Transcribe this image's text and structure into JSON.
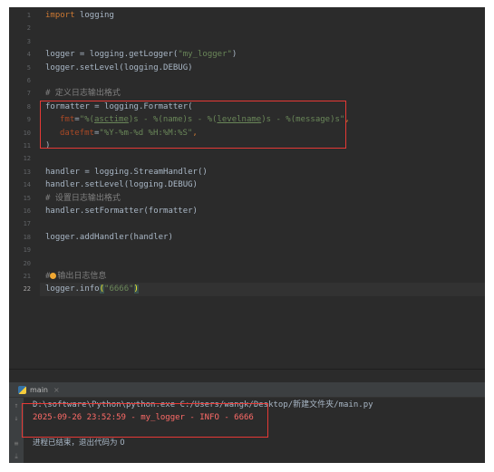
{
  "editor": {
    "line_numbers": [
      "1",
      "2",
      "3",
      "4",
      "5",
      "6",
      "7",
      "8",
      "9",
      "10",
      "11",
      "12",
      "13",
      "14",
      "15",
      "16",
      "17",
      "18",
      "19",
      "20",
      "21",
      "22"
    ],
    "current_line": "22",
    "code": {
      "l1_kw": "import",
      "l1_rest": " logging",
      "l4_a": "logger = logging.getLogger(",
      "l4_str": "\"my_logger\"",
      "l4_b": ")",
      "l5": "logger.setLevel(logging.DEBUG)",
      "l7": "# 定义日志输出格式",
      "l8": "formatter = logging.Formatter(",
      "l9_param": "fmt",
      "l9_eq": "=",
      "l9_s1": "\"%(",
      "l9_u1": "asctime",
      "l9_s2": ")s - %(name)s - %(",
      "l9_u2": "levelname",
      "l9_s3": ")s - %(message)s\"",
      "l9_end": ",",
      "l10_param": "datefmt",
      "l10_eq": "=",
      "l10_str": "\"%Y-%m-%d %H:%M:%S\"",
      "l10_end": ",",
      "l11": ")",
      "l13": "handler = logging.StreamHandler()",
      "l14": "handler.setLevel(logging.DEBUG)",
      "l15": "# 设置日志输出格式",
      "l16": "handler.setFormatter(formatter)",
      "l18": "logger.addHandler(handler)",
      "l21_hash": "#",
      "l21_text": "输出日志信息",
      "l22_a": "logger.info",
      "l22_open": "(",
      "l22_str": "\"6666\"",
      "l22_close": ")"
    }
  },
  "run": {
    "tab_label": "main",
    "tab_close": "×",
    "command": "D:\\software\\Python\\python.exe C:/Users/wangk/Desktop/新建文件夹/main.py",
    "log_line": "2025-09-26 23:52:59 - my_logger - INFO - 6666",
    "exit_message": "进程已结束，退出代码为 0"
  },
  "colors": {
    "highlight_box": "#e53935",
    "editor_bg": "#2b2b2b",
    "error_text": "#ff6b68"
  },
  "icons": [
    "python-icon",
    "close-icon",
    "arrow-up-icon",
    "arrow-down-icon",
    "wrap-icon",
    "scroll-end-icon",
    "intention-bulb-icon"
  ]
}
